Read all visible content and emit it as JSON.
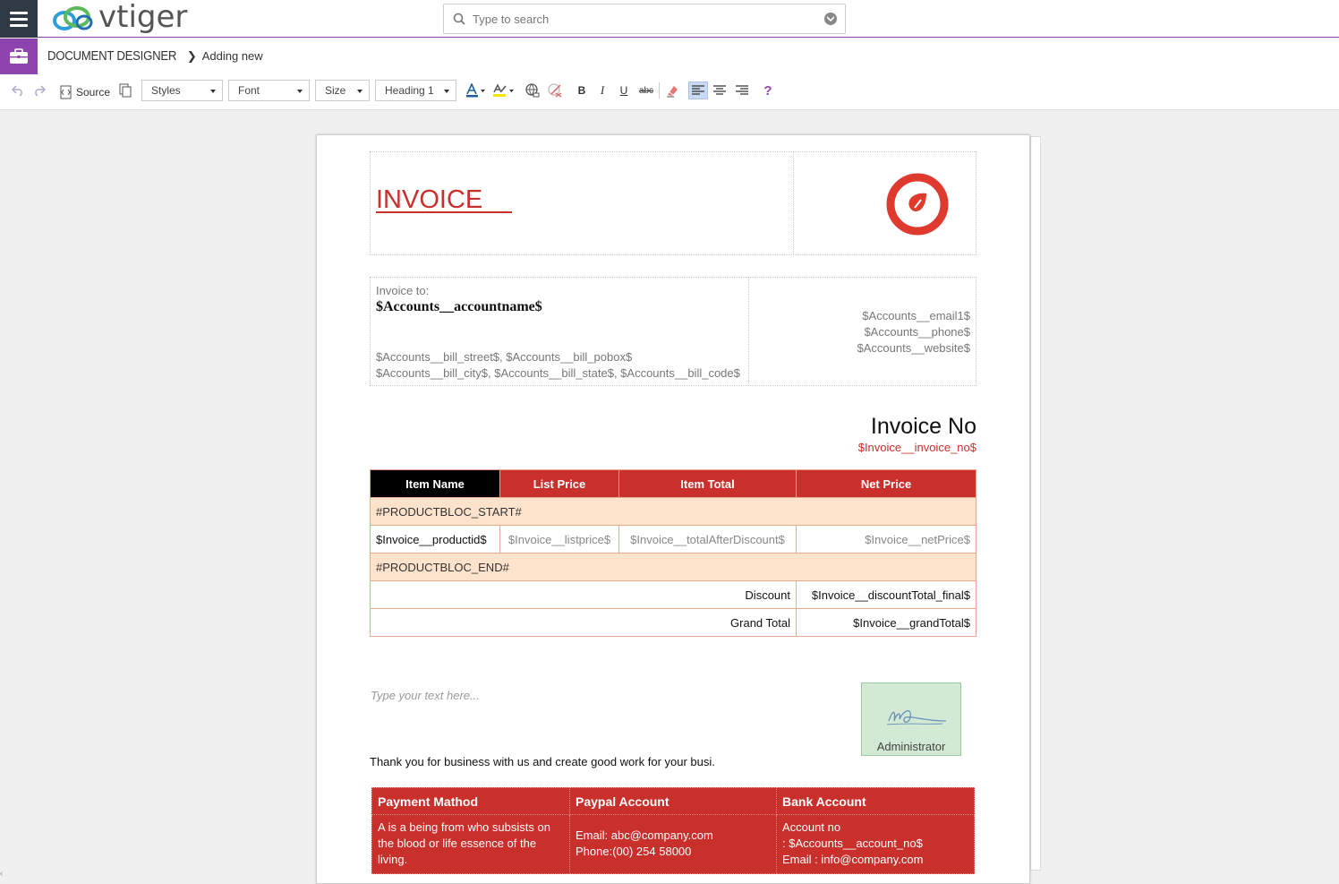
{
  "app": {
    "logo_text": "vtiger",
    "search_placeholder": "Type to search"
  },
  "breadcrumb": {
    "module": "DOCUMENT DESIGNER",
    "current": "Adding new"
  },
  "toolbar": {
    "source_label": "Source",
    "styles_label": "Styles",
    "font_label": "Font",
    "size_label": "Size",
    "format_label": "Heading 1",
    "bold": "B",
    "italic": "I",
    "underline": "U",
    "strike": "abc",
    "help": "?"
  },
  "doc": {
    "title": "INVOICE",
    "logo_color": "#e03a2f",
    "invoice_to_label": "Invoice to:",
    "account_name": "$Accounts__accountname$",
    "bill_line1": "$Accounts__bill_street$, $Accounts__bill_pobox$",
    "bill_line2": "$Accounts__bill_city$, $Accounts__bill_state$, $Accounts__bill_code$",
    "email": "$Accounts__email1$",
    "phone": "$Accounts__phone$",
    "website": "$Accounts__website$",
    "invoice_no_label": "Invoice No",
    "invoice_no_value": "$Invoice__invoice_no$",
    "table": {
      "headers": [
        "Item Name",
        "List Price",
        "Item Total",
        "Net Price"
      ],
      "bloc_start": "#PRODUCTBLOC_START#",
      "row": [
        "$Invoice__productid$",
        "$Invoice__listprice$",
        "$Invoice__totalAfterDiscount$",
        "$Invoice__netPrice$"
      ],
      "bloc_end": "#PRODUCTBLOC_END#",
      "discount_label": "Discount",
      "discount_value": "$Invoice__discountTotal_final$",
      "grand_label": "Grand Total",
      "grand_value": "$Invoice__grandTotal$"
    },
    "text_placeholder": "Type your text here...",
    "signature_name": "Administrator",
    "thanks": "Thank you for business with us and create good work for your busi.",
    "payment": {
      "headers": [
        "Payment Mathod",
        "Paypal Account",
        "Bank Account"
      ],
      "col1": "A is a being from who subsists on the blood or life essence of the living.",
      "col2_line1": "Email: abc@company.com",
      "col2_line2": "Phone:(00) 254 58000",
      "col3_line1": "Account no",
      "col3_line2": ": $Accounts__account_no$",
      "col3_line3": "Email : info@company.com"
    }
  },
  "colors": {
    "accent": "#8e44ad",
    "invoice_red": "#c9302c",
    "peach": "#fde3cc"
  }
}
